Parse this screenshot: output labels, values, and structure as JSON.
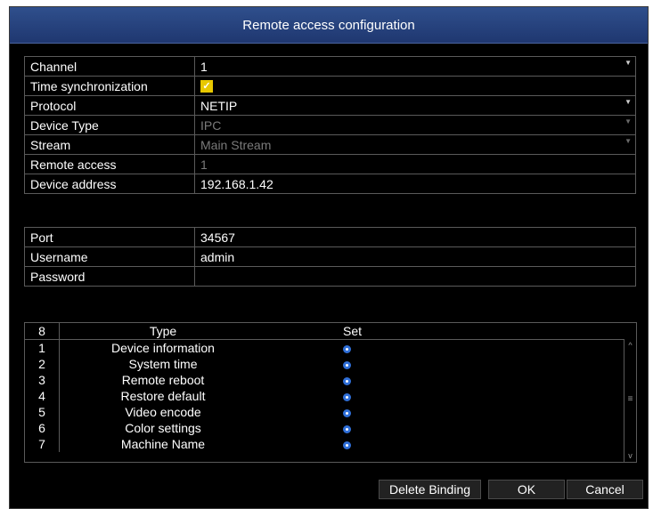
{
  "window": {
    "title": "Remote access configuration"
  },
  "settings": [
    {
      "label": "Channel",
      "value": "1",
      "dropdown": true,
      "disabled": false
    },
    {
      "label": "Time synchronization",
      "checked": true
    },
    {
      "label": "Protocol",
      "value": "NETIP",
      "dropdown": true,
      "disabled": false
    },
    {
      "label": "Device Type",
      "value": "IPC",
      "dropdown": true,
      "disabled": true
    },
    {
      "label": "Stream",
      "value": "Main Stream",
      "dropdown": true,
      "disabled": true
    },
    {
      "label": "Remote access",
      "value": "1",
      "disabled": true
    },
    {
      "label": "Device address",
      "value": "192.168.1.42"
    }
  ],
  "credentials": [
    {
      "label": "Port",
      "value": "34567"
    },
    {
      "label": "Username",
      "value": "admin"
    },
    {
      "label": "Password",
      "value": ""
    }
  ],
  "list": {
    "header": {
      "num": "8",
      "type": "Type",
      "set": "Set"
    },
    "rows": [
      {
        "num": "1",
        "type": "Device information"
      },
      {
        "num": "2",
        "type": "System time"
      },
      {
        "num": "3",
        "type": "Remote reboot"
      },
      {
        "num": "4",
        "type": "Restore default"
      },
      {
        "num": "5",
        "type": "Video encode"
      },
      {
        "num": "6",
        "type": "Color settings"
      },
      {
        "num": "7",
        "type": "Machine Name"
      }
    ]
  },
  "buttons": {
    "delete_binding": "Delete Binding",
    "ok": "OK",
    "cancel": "Cancel"
  },
  "colors": {
    "title_bar": "#2a4680",
    "checkbox": "#e8c800",
    "set_icon": "#2f6fd8"
  }
}
